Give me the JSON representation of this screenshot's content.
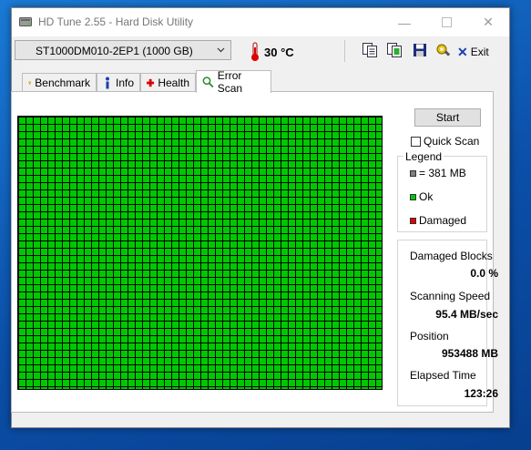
{
  "window": {
    "title": "HD Tune 2.55 - Hard Disk Utility",
    "minimize_glyph": "—",
    "maximize_glyph": "",
    "close_glyph": "✕"
  },
  "toolbar": {
    "drive": "ST1000DM010-2EP1 (1000 GB)",
    "temperature": "30 °C",
    "exit_label": "Exit",
    "icons": [
      "copy-text-icon",
      "copy-screenshot-icon",
      "save-icon",
      "options-icon"
    ]
  },
  "tabs": [
    {
      "label": "Benchmark",
      "icon": "benchmark-icon"
    },
    {
      "label": "Info",
      "icon": "info-icon"
    },
    {
      "label": "Health",
      "icon": "health-icon"
    },
    {
      "label": "Error Scan",
      "icon": "error-scan-icon",
      "active": true
    }
  ],
  "scan": {
    "start_label": "Start",
    "quick_scan_label": "Quick Scan",
    "quick_scan_checked": false,
    "block_status": "all-ok",
    "colors": {
      "ok": "#00c800",
      "damaged": "#e00000",
      "block": "#808080"
    }
  },
  "legend": {
    "title": "Legend",
    "block_size": "= 381 MB",
    "ok": "Ok",
    "damaged": "Damaged"
  },
  "stats": {
    "damaged_blocks_label": "Damaged Blocks",
    "damaged_blocks_value": "0.0 %",
    "scanning_speed_label": "Scanning Speed",
    "scanning_speed_value": "95.4 MB/sec",
    "position_label": "Position",
    "position_value": "953488 MB",
    "elapsed_time_label": "Elapsed Time",
    "elapsed_time_value": "123:26"
  }
}
